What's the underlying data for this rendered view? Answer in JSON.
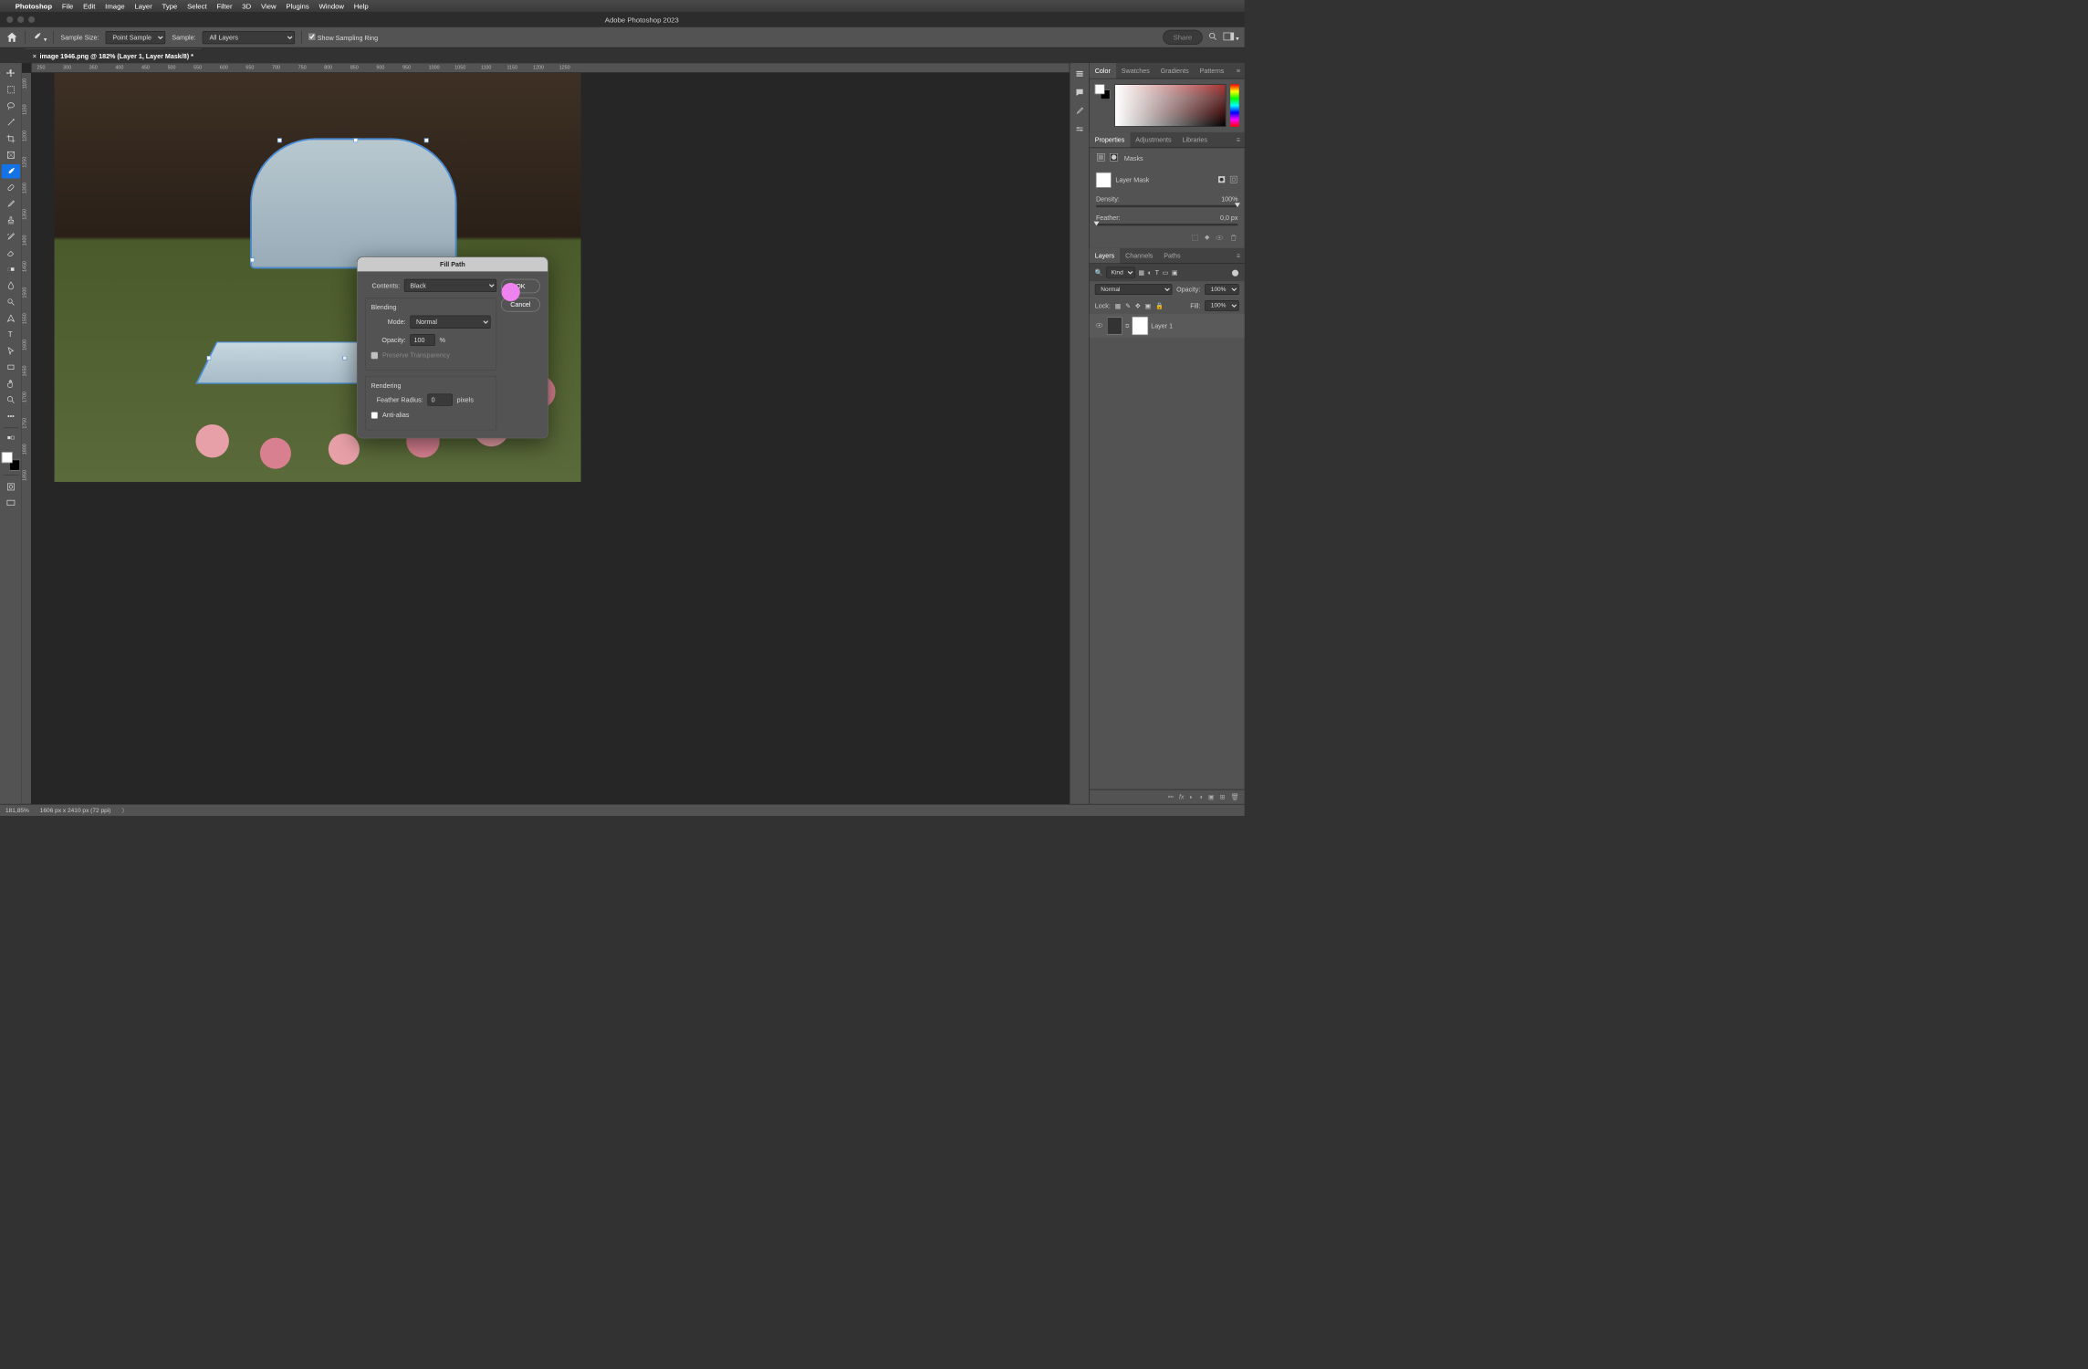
{
  "mac_menu": {
    "app": "Photoshop",
    "items": [
      "File",
      "Edit",
      "Image",
      "Layer",
      "Type",
      "Select",
      "Filter",
      "3D",
      "View",
      "Plugins",
      "Window",
      "Help"
    ]
  },
  "app_title": "Adobe Photoshop 2023",
  "options": {
    "sample_size_label": "Sample Size:",
    "sample_size": "Point Sample",
    "sample_label": "Sample:",
    "sample": "All Layers",
    "show_ring": "Show Sampling Ring",
    "share": "Share"
  },
  "document_tab": "image 1946.png @ 182% (Layer 1, Layer Mask/8) *",
  "ruler_h": [
    "250",
    "300",
    "350",
    "400",
    "450",
    "500",
    "550",
    "600",
    "650",
    "700",
    "750",
    "800",
    "850",
    "900",
    "950",
    "1000",
    "1050",
    "1100",
    "1150",
    "1200",
    "1250"
  ],
  "ruler_v": [
    "1100",
    "1150",
    "1200",
    "1250",
    "1300",
    "1350",
    "1400",
    "1450",
    "1500",
    "1550",
    "1600",
    "1650",
    "1700",
    "1750",
    "1800",
    "1850"
  ],
  "dialog": {
    "title": "Fill Path",
    "contents_label": "Contents:",
    "contents": "Black",
    "ok": "OK",
    "cancel": "Cancel",
    "blending": "Blending",
    "mode_label": "Mode:",
    "mode": "Normal",
    "opacity_label": "Opacity:",
    "opacity": "100",
    "pct": "%",
    "preserve": "Preserve Transparency",
    "rendering": "Rendering",
    "feather_label": "Feather Radius:",
    "feather": "0",
    "pixels": "pixels",
    "antialias": "Anti-alias"
  },
  "color_tabs": [
    "Color",
    "Swatches",
    "Gradients",
    "Patterns"
  ],
  "prop_tabs": [
    "Properties",
    "Adjustments",
    "Libraries"
  ],
  "masks": {
    "title": "Masks",
    "subtitle": "Layer Mask",
    "density_label": "Density:",
    "density": "100%",
    "feather_label": "Feather:",
    "feather": "0,0 px"
  },
  "layer_tabs": [
    "Layers",
    "Channels",
    "Paths"
  ],
  "layers": {
    "kind": "Kind",
    "blend": "Normal",
    "opacity_label": "Opacity:",
    "opacity": "100%",
    "lock_label": "Lock:",
    "fill_label": "Fill:",
    "fill": "100%",
    "layer1": "Layer 1"
  },
  "status": {
    "zoom": "181,85%",
    "dims": "1606 px x 2410 px (72 ppi)"
  }
}
